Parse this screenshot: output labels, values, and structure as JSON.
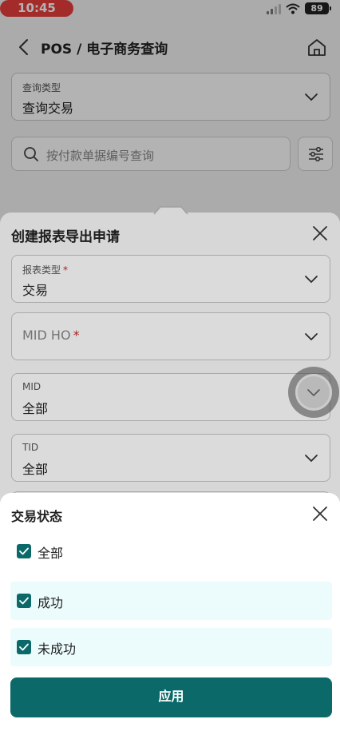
{
  "status_bar": {
    "time": "10:45",
    "battery": "89"
  },
  "header": {
    "title": "POS / 电子商务查询"
  },
  "query": {
    "label": "查询类型",
    "value": "查询交易"
  },
  "search": {
    "placeholder": "按付款单据编号查询"
  },
  "report_sheet": {
    "title": "创建报表导出申请",
    "fields": [
      {
        "label": "报表类型",
        "required": "*",
        "value": "交易"
      },
      {
        "label": "MID HO",
        "required": "*",
        "value": ""
      },
      {
        "label": "MID",
        "value": "全部"
      },
      {
        "label": "TID",
        "value": "全部"
      }
    ]
  },
  "status_sheet": {
    "title": "交易状态",
    "options": [
      {
        "label": "全部",
        "checked": true
      },
      {
        "label": "成功",
        "checked": true
      },
      {
        "label": "未成功",
        "checked": true
      }
    ],
    "apply_label": "应用"
  },
  "colors": {
    "accent": "#0b6a69",
    "time_pill": "#e8403f",
    "highlight": "#ecfcfc",
    "required": "#c0282a"
  },
  "icons": [
    "back-icon",
    "home-icon",
    "search-icon",
    "filter-icon",
    "chevron-down-icon",
    "close-icon",
    "checkbox-checked-icon",
    "wifi-icon",
    "signal-icon",
    "battery-icon"
  ]
}
